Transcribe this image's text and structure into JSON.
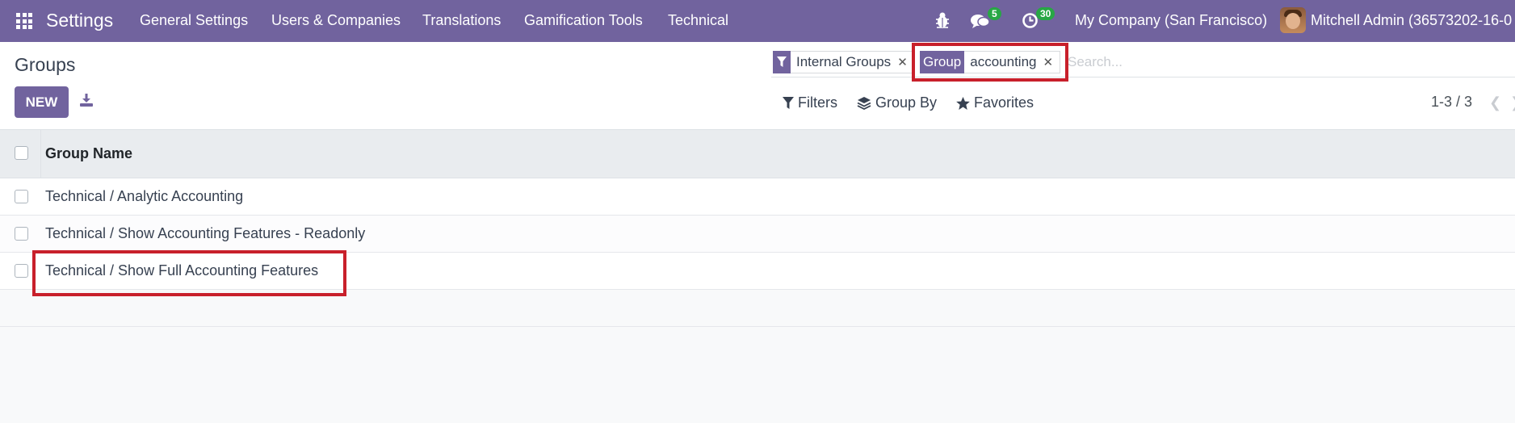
{
  "navbar": {
    "brand": "Settings",
    "menu": [
      "General Settings",
      "Users & Companies",
      "Translations",
      "Gamification Tools",
      "Technical"
    ],
    "messages_count": "5",
    "activities_count": "30",
    "company": "My Company (San Francisco)",
    "user": "Mitchell Admin (36573202-16-0"
  },
  "control_panel": {
    "title": "Groups",
    "new_label": "NEW",
    "facets": [
      {
        "icon": "filter-icon",
        "value": "Internal Groups"
      },
      {
        "label": "Group",
        "value": "accounting"
      }
    ],
    "search_placeholder": "Search...",
    "filters_label": "Filters",
    "group_by_label": "Group By",
    "favorites_label": "Favorites",
    "pager": "1-3 / 3"
  },
  "table": {
    "column": "Group Name",
    "rows": [
      "Technical / Analytic Accounting",
      "Technical / Show Accounting Features - Readonly",
      "Technical / Show Full Accounting Features"
    ]
  },
  "colors": {
    "brand": "#71639e",
    "highlight": "#c8202b",
    "badge": "#28a745"
  }
}
